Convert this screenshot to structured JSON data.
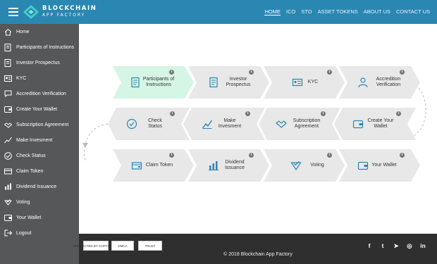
{
  "brand": {
    "line1": "BLOCKCHAIN",
    "line2": "APP FACTORY"
  },
  "colors": {
    "topbar": "#2a87b1",
    "sidebar": "#555759",
    "active_step": "#d5f5e5",
    "step": "#e8e8e8",
    "footer": "#2f2f2f"
  },
  "topnav": [
    {
      "label": "HOME",
      "active": true
    },
    {
      "label": "ICO"
    },
    {
      "label": "STO"
    },
    {
      "label": "ASSET TOKENS"
    },
    {
      "label": "ABOUT US"
    },
    {
      "label": "CONTACT US"
    }
  ],
  "sidebar": {
    "items": [
      {
        "label": "Home",
        "icon": "home-icon"
      },
      {
        "label": "Participants of Instructions",
        "icon": "document-icon"
      },
      {
        "label": "Investor Prospectus",
        "icon": "document-icon"
      },
      {
        "label": "KYC",
        "icon": "id-card-icon"
      },
      {
        "label": "Accredition Verification",
        "icon": "chat-icon"
      },
      {
        "label": "Create Your Wallet",
        "icon": "wallet-icon"
      },
      {
        "label": "Subscription Agreement",
        "icon": "handshake-icon"
      },
      {
        "label": "Make Invesment",
        "icon": "chart-icon"
      },
      {
        "label": "Check Status",
        "icon": "check-circle-icon"
      },
      {
        "label": "Claim Token",
        "icon": "token-icon"
      },
      {
        "label": "Dividend Issuance",
        "icon": "bar-chart-icon"
      },
      {
        "label": "Voting",
        "icon": "vote-icon"
      },
      {
        "label": "Your Wallet",
        "icon": "wallet-icon"
      },
      {
        "label": "Logout",
        "icon": "logout-icon"
      }
    ]
  },
  "steps": {
    "row1": [
      {
        "label": "Participants of Instructions",
        "icon": "document-icon",
        "active": true
      },
      {
        "label": "Investor Prospectus",
        "icon": "document-icon"
      },
      {
        "label": "KYC",
        "icon": "id-card-icon"
      },
      {
        "label": "Accredition Verification",
        "icon": "user-badge-icon"
      }
    ],
    "row2": [
      {
        "label": "Check Status",
        "icon": "check-circle-icon"
      },
      {
        "label": "Make Invesment",
        "icon": "chart-icon"
      },
      {
        "label": "Subscription Agreement",
        "icon": "handshake-icon"
      },
      {
        "label": "Create Your Wallet",
        "icon": "wallet-icon"
      }
    ],
    "row3": [
      {
        "label": "Claim Token",
        "icon": "token-icon"
      },
      {
        "label": "Dividend Issuance",
        "icon": "bar-chart-icon"
      },
      {
        "label": "Voting",
        "icon": "vote-icon"
      },
      {
        "label": "Your Wallet",
        "icon": "wallet-icon"
      }
    ],
    "info_glyph": "i"
  },
  "footer": {
    "badges": [
      "PROTECTED BY COPYSCAPE",
      "DMCA",
      "TRUST"
    ],
    "copyright": "© 2018 Blockchain App Factory",
    "social": [
      {
        "glyph": "f",
        "icon": "facebook-icon"
      },
      {
        "glyph": "t",
        "icon": "twitter-icon"
      },
      {
        "glyph": "➤",
        "icon": "telegram-icon"
      },
      {
        "glyph": "◎",
        "icon": "instagram-icon"
      },
      {
        "glyph": "in",
        "icon": "linkedin-icon"
      }
    ]
  }
}
